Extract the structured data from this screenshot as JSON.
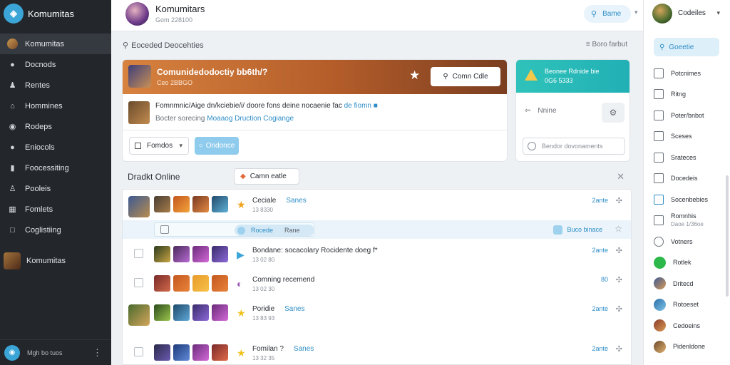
{
  "sidebar": {
    "brand_title": "Komumitas",
    "items": [
      {
        "label": "Komumitas",
        "icon": "avatar-icon",
        "glyph": ""
      },
      {
        "label": "Docnods",
        "icon": "chat-icon",
        "glyph": "●"
      },
      {
        "label": "Rentes",
        "icon": "user-icon",
        "glyph": "♟"
      },
      {
        "label": "Hommines",
        "icon": "home-icon",
        "glyph": "⌂"
      },
      {
        "label": "Rodeps",
        "icon": "camera-icon",
        "glyph": "◉"
      },
      {
        "label": "Eniocols",
        "icon": "circle-icon",
        "glyph": "●"
      },
      {
        "label": "Foocessiting",
        "icon": "bookmark-icon",
        "glyph": "▮"
      },
      {
        "label": "Pooleis",
        "icon": "people-icon",
        "glyph": "♙"
      },
      {
        "label": "Fomlets",
        "icon": "image-icon",
        "glyph": "▦"
      },
      {
        "label": "Coglistiing",
        "icon": "square-icon",
        "glyph": "□"
      }
    ],
    "community_label": "Komumitas",
    "user_name": "Mgh bo tuos"
  },
  "header": {
    "title": "Komumitars",
    "subtitle": "Gom 228100",
    "search_label": "Bame"
  },
  "section": {
    "title": "Eoceded Deocehties",
    "link": "Boro farbut"
  },
  "banner": {
    "title": "Comunidedodoctiy bb6th/?",
    "subtitle": "Ceo 2BBGO",
    "button_label": "Comn Cdle"
  },
  "post": {
    "text": "Fomnmnic/Aige dn/kciebie/i/ doore fons deine nocaenie fac",
    "text_link": "de fiomn ■",
    "meta_prefix": "Bocter sorecing",
    "meta_link": "Moaaog Druction Cogiange"
  },
  "filter": {
    "select_label": "Fomdos",
    "button_label": "Ondonce"
  },
  "side_card": {
    "line1": "Beonee Rdnide bie",
    "line2": "0G6 5333",
    "online_label": "Nnine",
    "input_placeholder": "Bendor dovonaments"
  },
  "online": {
    "title": "Dradkt Online",
    "button_label": "Camn eatle"
  },
  "rows": [
    {
      "title": "Ceciale",
      "tag": "Sanes",
      "time": "13 8330",
      "num": "2ante",
      "icon": "star-icon",
      "glyph": "★",
      "icon_color": "#f2a31d",
      "has_avatar": true
    },
    {
      "title": "Bondane: socacolary Rocidente doeg f*",
      "tag": "",
      "time": "13 02 80",
      "num": "2ante",
      "icon": "play-icon",
      "glyph": "▶",
      "icon_color": "#3aa5d6",
      "has_avatar": false
    },
    {
      "title": "Comning recemend",
      "tag": "",
      "time": "13 02 30",
      "num": "80",
      "icon": "emoji-icon",
      "glyph": "◐",
      "icon_color": "#9b59b6",
      "has_avatar": false
    },
    {
      "title": "Poridie",
      "tag": "Sanes",
      "time": "13 83 93",
      "num": "2ante",
      "icon": "star-icon",
      "glyph": "★",
      "icon_color": "#f2c31d",
      "has_avatar": true
    },
    {
      "title": "Fomilan ?",
      "tag": "Sanes",
      "time": "13 32 35",
      "num": "2ante",
      "icon": "star-icon",
      "glyph": "★",
      "icon_color": "#f2c31d",
      "has_avatar": false
    }
  ],
  "subrow": {
    "pill_label": "Rocede",
    "pill_tail": "Rane",
    "right_label": "Buco binace"
  },
  "right_panel": {
    "user_name": "Codeiles",
    "search_label": "Goeetie",
    "items": [
      {
        "label": "Potcnimes",
        "sub": "",
        "icon": "doc-icon"
      },
      {
        "label": "Ritng",
        "sub": "",
        "icon": "calendar-icon"
      },
      {
        "label": "Poter/bnbot",
        "sub": "",
        "icon": "file-icon"
      },
      {
        "label": "Sceses",
        "sub": "",
        "icon": "image-icon"
      },
      {
        "label": "Srateces",
        "sub": "",
        "icon": "grid-icon"
      },
      {
        "label": "Docedeis",
        "sub": "",
        "icon": "folder-icon"
      },
      {
        "label": "Socenbebies",
        "sub": "",
        "icon": "table-icon"
      },
      {
        "label": "Romnhis",
        "sub": "Daoe 1/36oe",
        "icon": "square-icon"
      },
      {
        "label": "Votners",
        "sub": "",
        "icon": "circle-icon"
      },
      {
        "label": "Rotlek",
        "sub": "",
        "icon": "green-dot-icon"
      },
      {
        "label": "Dritecd",
        "sub": "",
        "icon": "avatar-icon"
      },
      {
        "label": "Rotoeset",
        "sub": "",
        "icon": "avatar-icon"
      },
      {
        "label": "Cedoeins",
        "sub": "",
        "icon": "avatar-icon"
      },
      {
        "label": "Pidenldone",
        "sub": "",
        "icon": "avatar-icon"
      }
    ]
  },
  "colors": {
    "accent": "#2f8ec7",
    "sidebar_bg": "#23272c",
    "banner_orange": "#c8702f",
    "teal": "#28b9b6"
  }
}
